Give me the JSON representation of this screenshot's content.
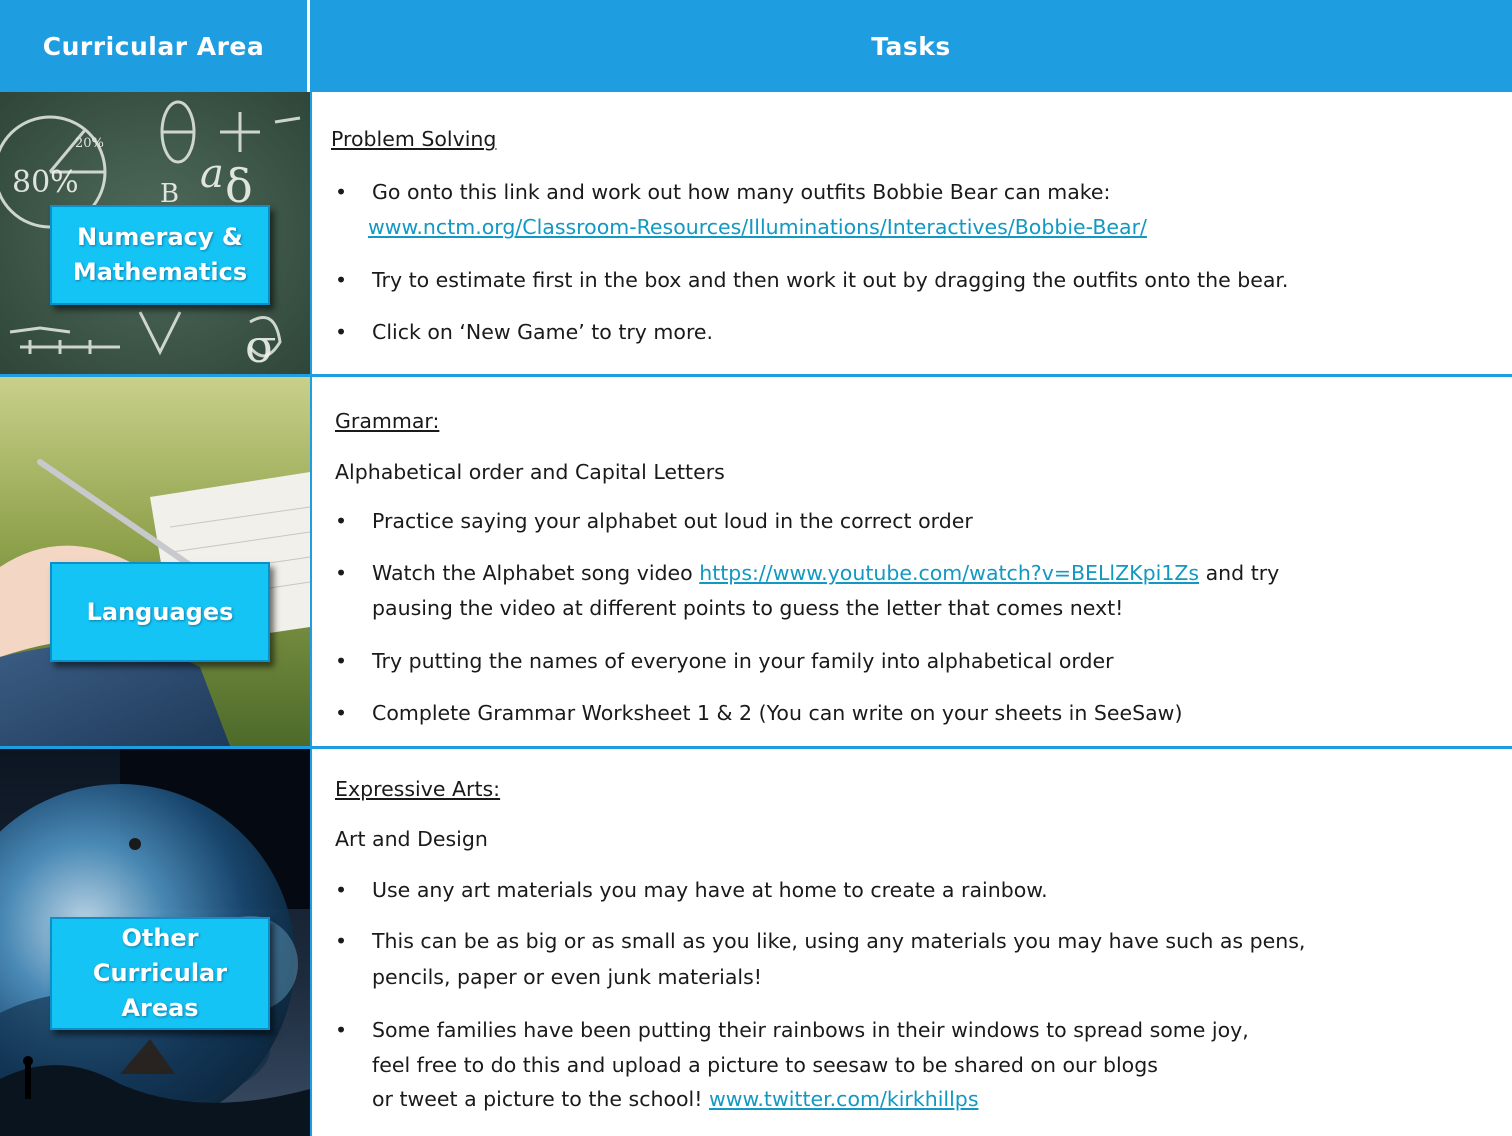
{
  "header": {
    "left": "Curricular Area",
    "right": "Tasks"
  },
  "rows": [
    {
      "area": "Numeracy & Mathematics",
      "heading": "Problem Solving",
      "bullets": [
        {
          "text": "Go onto this link and work out how many outfits Bobbie Bear can make:",
          "link": "www.nctm.org/Classroom-Resources/Illuminations/Interactives/Bobbie-Bear/"
        },
        {
          "text": "Try to estimate first in the box and then work it out by dragging the outfits onto the bear."
        },
        {
          "text": "Click on ‘New Game’ to try more."
        }
      ]
    },
    {
      "area": "Languages",
      "heading": "Grammar:",
      "subheading": "Alphabetical order and Capital Letters",
      "bullets": [
        {
          "text": "Practice saying your alphabet out loud in the correct order"
        },
        {
          "pre": "Watch the Alphabet song video ",
          "link": "https://www.youtube.com/watch?v=BELlZKpi1Zs",
          "post": " and try",
          "line2": "pausing the video at different points to guess the letter that comes next!"
        },
        {
          "text": "Try putting the names of everyone in your family into alphabetical order"
        },
        {
          "text": "Complete Grammar Worksheet 1 & 2 (You can write on your sheets in SeeSaw)"
        }
      ]
    },
    {
      "area": "Other Curricular Areas",
      "heading": "Expressive Arts:",
      "subheading": "Art and Design",
      "bullets": [
        {
          "text": "Use any art materials you may have at home to create a rainbow."
        },
        {
          "line1": "This can be as big or as small as you like, using any materials you may have such as pens,",
          "line2": "pencils, paper or even junk materials!"
        },
        {
          "line1": "Some families have been putting their rainbows in their windows to spread some joy,",
          "line2": "feel free to do this and upload a picture to seesaw to be shared on our blogs",
          "line3pre": "or tweet a picture to the school! ",
          "link": "www.twitter.com/kirkhillps"
        }
      ]
    }
  ]
}
